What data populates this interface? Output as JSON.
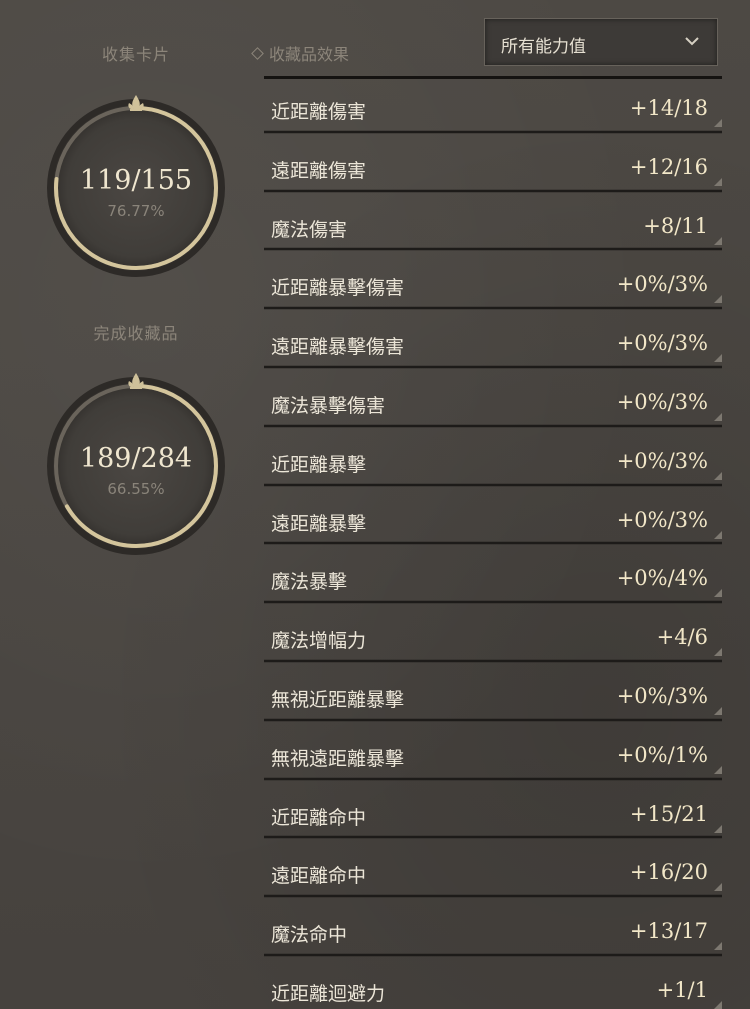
{
  "left_panel": {
    "cards_label": "收集卡片",
    "cards_count": "119/155",
    "cards_percent": "76.77%",
    "cards_progress": 0.7677,
    "collections_label": "完成收藏品",
    "collections_count": "189/284",
    "collections_percent": "66.55%",
    "collections_progress": 0.6655
  },
  "header": {
    "tab_label": "收藏品效果",
    "dropdown_value": "所有能力值"
  },
  "stats": [
    {
      "name": "近距離傷害",
      "value": "+14/18"
    },
    {
      "name": "遠距離傷害",
      "value": "+12/16"
    },
    {
      "name": "魔法傷害",
      "value": "+8/11"
    },
    {
      "name": "近距離暴擊傷害",
      "value": "+0%/3%"
    },
    {
      "name": "遠距離暴擊傷害",
      "value": "+0%/3%"
    },
    {
      "name": "魔法暴擊傷害",
      "value": "+0%/3%"
    },
    {
      "name": "近距離暴擊",
      "value": "+0%/3%"
    },
    {
      "name": "遠距離暴擊",
      "value": "+0%/3%"
    },
    {
      "name": "魔法暴擊",
      "value": "+0%/4%"
    },
    {
      "name": "魔法增幅力",
      "value": "+4/6"
    },
    {
      "name": "無視近距離暴擊",
      "value": "+0%/3%"
    },
    {
      "name": "無視遠距離暴擊",
      "value": "+0%/1%"
    },
    {
      "name": "近距離命中",
      "value": "+15/21"
    },
    {
      "name": "遠距離命中",
      "value": "+16/20"
    },
    {
      "name": "魔法命中",
      "value": "+13/17"
    },
    {
      "name": "近距離迴避力",
      "value": "+1/1"
    }
  ],
  "colors": {
    "ring_gold": "#cfc19a",
    "value_text": "#f2e7c8"
  },
  "icons": {
    "fleur": "fleur-de-lis-icon",
    "chevron": "chevron-down-icon",
    "diamond": "diamond-icon"
  }
}
